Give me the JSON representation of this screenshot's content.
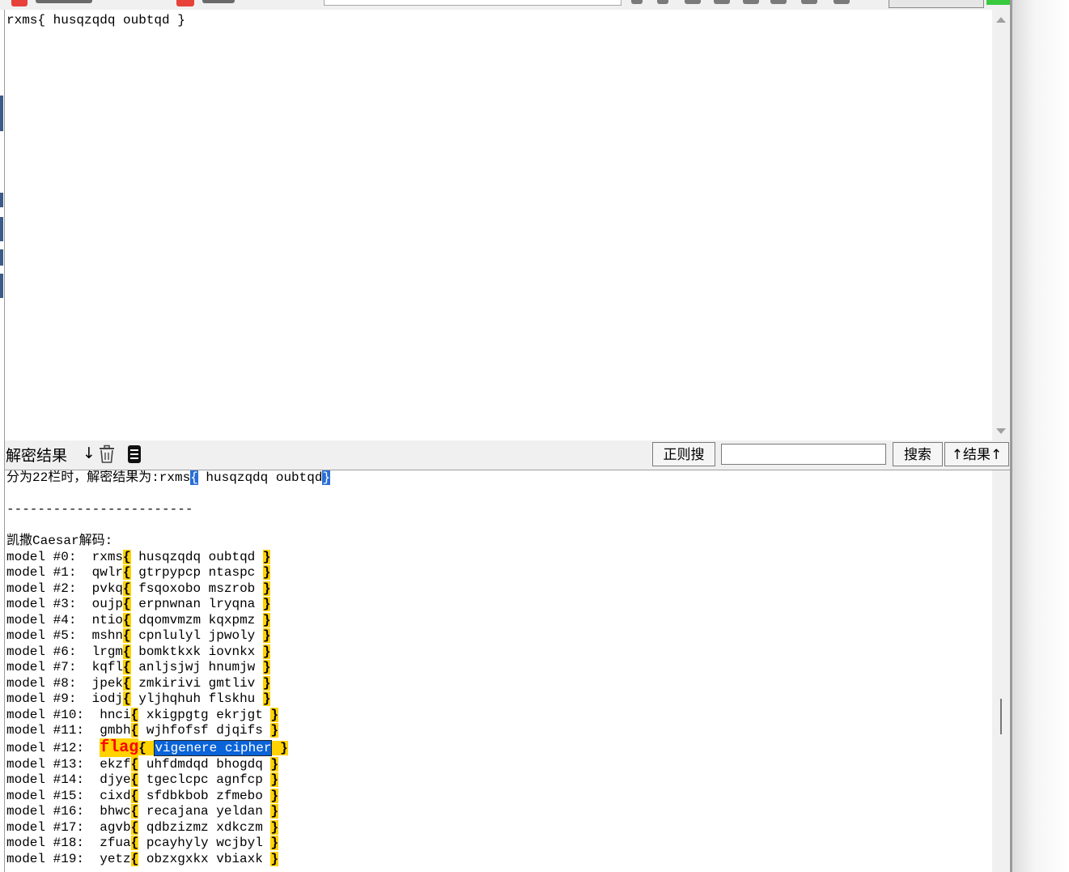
{
  "input": {
    "text": "rxms{ husqzqdq oubtqd }"
  },
  "toolbar": {
    "result_label": "解密结果",
    "down_arrow": "↓",
    "regex_button": "正则搜",
    "search_button": "搜索",
    "up_result_button": "↑结果↑",
    "trash_icon": "trash-icon",
    "doc_icon": "document-icon"
  },
  "output": {
    "rail_line": {
      "prefix": "分为22栏时，解密结果为:rxms",
      "open": "{",
      "middle": " husqzqdq oubtqd",
      "close": "}"
    },
    "separator": "------------------------",
    "caesar_header": "凯撒Caesar解码:",
    "rows": [
      {
        "label": "model #0:  ",
        "word": "rxms",
        "body": " husqzqdq oubtqd "
      },
      {
        "label": "model #1:  ",
        "word": "qwlr",
        "body": " gtrpypcp ntaspc "
      },
      {
        "label": "model #2:  ",
        "word": "pvkq",
        "body": " fsqoxobo mszrob "
      },
      {
        "label": "model #3:  ",
        "word": "oujp",
        "body": " erpnwnan lryqna "
      },
      {
        "label": "model #4:  ",
        "word": "ntio",
        "body": " dqomvmzm kqxpmz "
      },
      {
        "label": "model #5:  ",
        "word": "mshn",
        "body": " cpnlulyl jpwoly "
      },
      {
        "label": "model #6:  ",
        "word": "lrgm",
        "body": " bomktkxk iovnkx "
      },
      {
        "label": "model #7:  ",
        "word": "kqfl",
        "body": " anljsjwj hnumjw "
      },
      {
        "label": "model #8:  ",
        "word": "jpek",
        "body": " zmkirivi gmtliv "
      },
      {
        "label": "model #9:  ",
        "word": "iodj",
        "body": " yljhqhuh flskhu "
      },
      {
        "label": "model #10:  ",
        "word": "hnci",
        "body": " xkigpgtg ekrjgt "
      },
      {
        "label": "model #11:  ",
        "word": "gmbh",
        "body": " wjhfofsf djqifs "
      },
      {
        "label": "model #12:  ",
        "word": "flag",
        "body": "vigenere cipher",
        "special": true
      },
      {
        "label": "model #13:  ",
        "word": "ekzf",
        "body": " uhfdmdqd bhogdq "
      },
      {
        "label": "model #14:  ",
        "word": "djye",
        "body": " tgeclcpc agnfcp "
      },
      {
        "label": "model #15:  ",
        "word": "cixd",
        "body": " sfdbkbob zfmebo "
      },
      {
        "label": "model #16:  ",
        "word": "bhwc",
        "body": " recajana yeldan "
      },
      {
        "label": "model #17:  ",
        "word": "agvb",
        "body": " qdbzizmz xdkczm "
      },
      {
        "label": "model #18:  ",
        "word": "zfua",
        "body": " pcayhyly wcjbyl "
      },
      {
        "label": "model #19:  ",
        "word": "yetz",
        "body": " obzxgxkx vbiaxk "
      }
    ]
  }
}
